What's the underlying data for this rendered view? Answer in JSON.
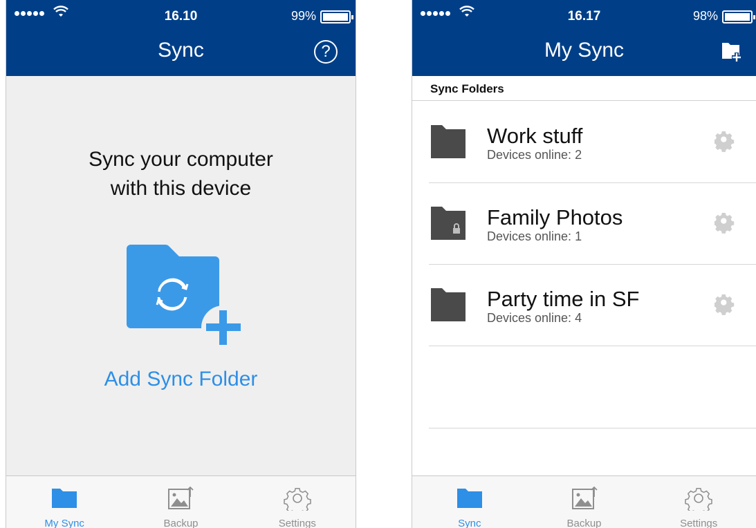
{
  "left": {
    "status": {
      "time": "16.10",
      "battery": "99%"
    },
    "nav": {
      "title": "Sync",
      "help_label": "?"
    },
    "empty": {
      "line1": "Sync your computer",
      "line2": "with this device",
      "add_label": "Add Sync Folder"
    },
    "tabs": [
      {
        "label": "My Sync",
        "icon": "folder-icon",
        "active": true
      },
      {
        "label": "Backup",
        "icon": "image-upload-icon",
        "active": false
      },
      {
        "label": "Settings",
        "icon": "gear-icon",
        "active": false
      }
    ]
  },
  "right": {
    "status": {
      "time": "16.17",
      "battery": "98%"
    },
    "nav": {
      "title": "My Sync"
    },
    "section": "Sync Folders",
    "folders": [
      {
        "name": "Work stuff",
        "devices": "Devices online: 2",
        "locked": false
      },
      {
        "name": "Family Photos",
        "devices": "Devices online: 1",
        "locked": true
      },
      {
        "name": "Party time in SF",
        "devices": "Devices online: 4",
        "locked": false
      }
    ],
    "tabs": [
      {
        "label": "Sync",
        "icon": "folder-icon",
        "active": true
      },
      {
        "label": "Backup",
        "icon": "image-upload-icon",
        "active": false
      },
      {
        "label": "Settings",
        "icon": "gear-icon",
        "active": false
      }
    ]
  },
  "colors": {
    "navbar": "#003f88",
    "accent": "#2d8fe6",
    "folder_dark": "#4a4a4a"
  }
}
